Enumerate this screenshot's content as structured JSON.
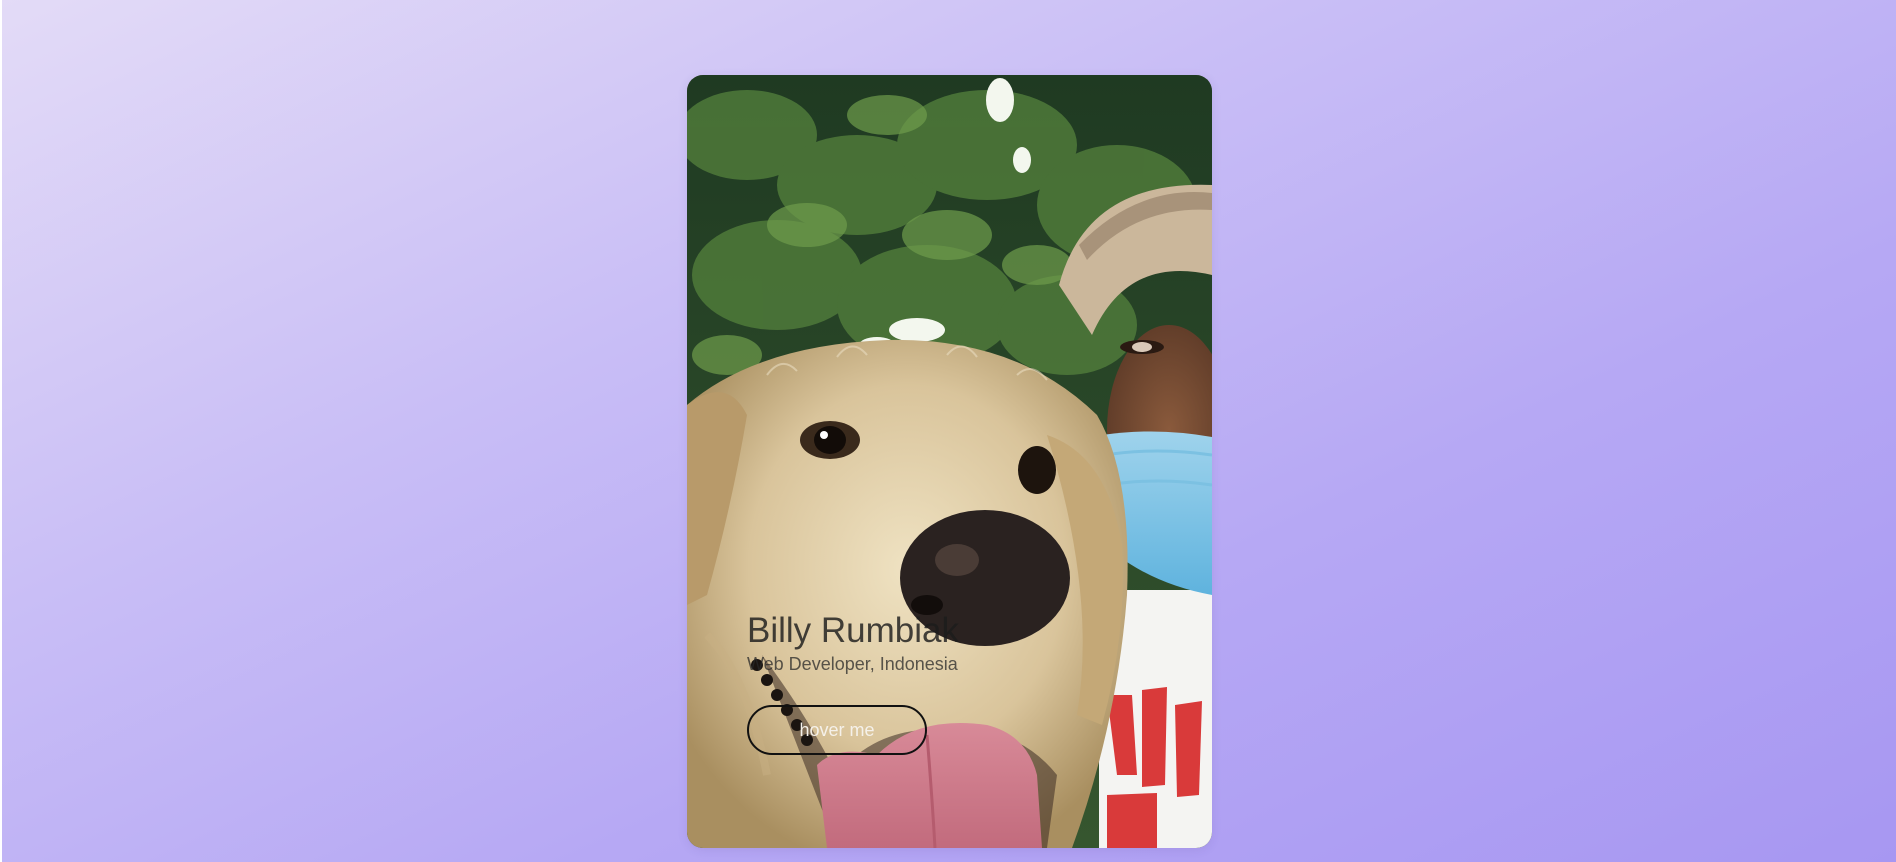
{
  "profile_card": {
    "photo_alt": "Selfie of a golden retriever and a man wearing a cap and face mask under a tree",
    "name": "Billy Rumbiak",
    "subtitle": "Web Developer, Indonesia",
    "button_label": "hover me"
  },
  "colors": {
    "background_start": "#e3dbf7",
    "background_end": "#a797f2",
    "button_border": "#111111"
  }
}
